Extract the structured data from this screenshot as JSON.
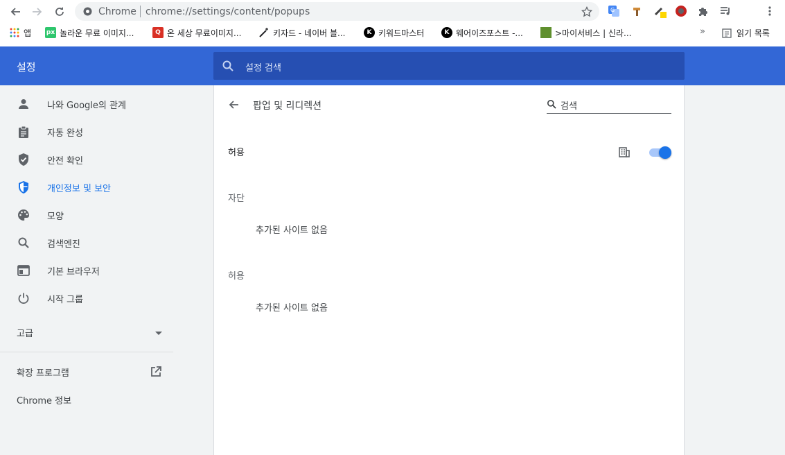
{
  "browser": {
    "omnibox_scheme": "Chrome",
    "omnibox_url": "chrome://settings/content/popups"
  },
  "bookmarks": {
    "items": [
      {
        "label": "앱"
      },
      {
        "label": "놀라운 무료 이미지..."
      },
      {
        "label": "온 세상 무료이미지..."
      },
      {
        "label": "키자드 - 네이버 블..."
      },
      {
        "label": "키워드마스터"
      },
      {
        "label": "웨어이즈포스트 -..."
      },
      {
        "label": ">마이서비스 | 신라..."
      }
    ],
    "more_label": "»",
    "reading_list_label": "읽기 목록"
  },
  "header": {
    "title": "설정",
    "search_placeholder": "설정 검색"
  },
  "sidebar": {
    "items": [
      {
        "label": "나와 Google의 관계",
        "icon": "person-icon"
      },
      {
        "label": "자동 완성",
        "icon": "clipboard-icon"
      },
      {
        "label": "안전 확인",
        "icon": "shield-check-icon"
      },
      {
        "label": "개인정보 및 보안",
        "icon": "privacy-shield-icon",
        "active": true
      },
      {
        "label": "모양",
        "icon": "palette-icon"
      },
      {
        "label": "검색엔진",
        "icon": "search-icon"
      },
      {
        "label": "기본 브라우저",
        "icon": "browser-window-icon"
      },
      {
        "label": "시작 그룹",
        "icon": "power-icon"
      }
    ],
    "advanced_label": "고급",
    "extensions_label": "확장 프로그램",
    "about_label": "Chrome 정보"
  },
  "main": {
    "title": "팝업 및 리디렉션",
    "search_placeholder": "검색",
    "allow_toggle_label": "허용",
    "allow_toggle_on": true,
    "block_section": {
      "label": "자단",
      "empty_text": "추가된 사이트 없음"
    },
    "allow_section": {
      "label": "허용",
      "empty_text": "추가된 사이트 없음"
    }
  },
  "colors": {
    "header_blue": "#3367d6",
    "header_search": "#264fb2",
    "accent": "#1a73e8",
    "sidebar_bg": "#f1f3f4"
  }
}
